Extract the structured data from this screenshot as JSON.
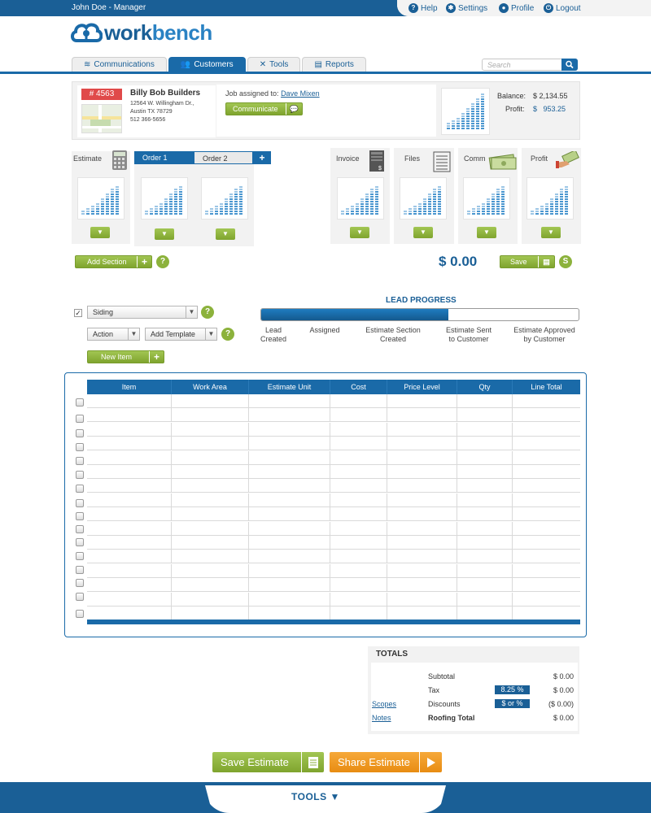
{
  "topbar": {
    "user": "John Doe - Manager",
    "help": "Help",
    "settings": "Settings",
    "profile": "Profile",
    "logout": "Logout"
  },
  "logo": {
    "first": "work",
    "second": "bench"
  },
  "tabs": [
    {
      "label": "Communications"
    },
    {
      "label": "Customers"
    },
    {
      "label": "Tools"
    },
    {
      "label": "Reports"
    }
  ],
  "search": {
    "placeholder": "Search"
  },
  "customer": {
    "id": "# 4563",
    "name": "Billy Bob Builders",
    "address1": "12564 W. Willingham Dr.,",
    "address2": "Austin TX 78729",
    "phone": "512 366-5656"
  },
  "job": {
    "label": "Job assigned to:",
    "assignee": "Dave Mixen",
    "communicate": "Communicate"
  },
  "balance": {
    "balance_label": "Balance:",
    "balance_value": "$ 2,134.55",
    "profit_label": "Profit:",
    "profit_currency": "$",
    "profit_value": "953.25"
  },
  "panels": {
    "estimate": "Estimate",
    "order1": "Order 1",
    "order2": "Order 2",
    "plus": "+",
    "invoice": "Invoice",
    "files": "Files",
    "comm": "Comm",
    "profit": "Profit"
  },
  "actions": {
    "add_section": "Add Section",
    "total": "$ 0.00",
    "save": "Save"
  },
  "lead": {
    "title": "LEAD PROGRESS",
    "progress": 0.59,
    "steps": [
      "Lead\nCreated",
      "Assigned",
      "Estimate Section\nCreated",
      "Estimate Sent\nto Customer",
      "Estimate Approved\nby Customer"
    ]
  },
  "controls": {
    "siding": "Siding",
    "action": "Action",
    "add_template": "Add Template",
    "new_item": "New Item",
    "help": "?"
  },
  "table": {
    "columns": [
      "Item",
      "Work Area",
      "Estimate Unit",
      "Cost",
      "Price Level",
      "Qty",
      "Line Total"
    ]
  },
  "totals": {
    "title": "TOTALS",
    "subtotal_label": "Subtotal",
    "subtotal": "$ 0.00",
    "tax_label": "Tax",
    "tax_rate": "8.25 %",
    "tax": "$ 0.00",
    "scopes": "Scopes",
    "discounts_label": "Discounts",
    "discount_type": "$ or %",
    "discounts": "($ 0.00)",
    "notes": "Notes",
    "roofing_label": "Roofing Total",
    "roofing": "$ 0.00"
  },
  "buttons": {
    "save_estimate": "Save Estimate",
    "share_estimate": "Share Estimate"
  },
  "footer": {
    "tools": "TOOLS"
  },
  "colors": {
    "primary": "#1a5f96",
    "accent_green": "#8cb23c",
    "orange": "#f39a1e",
    "badge_red": "#e04a4a"
  }
}
